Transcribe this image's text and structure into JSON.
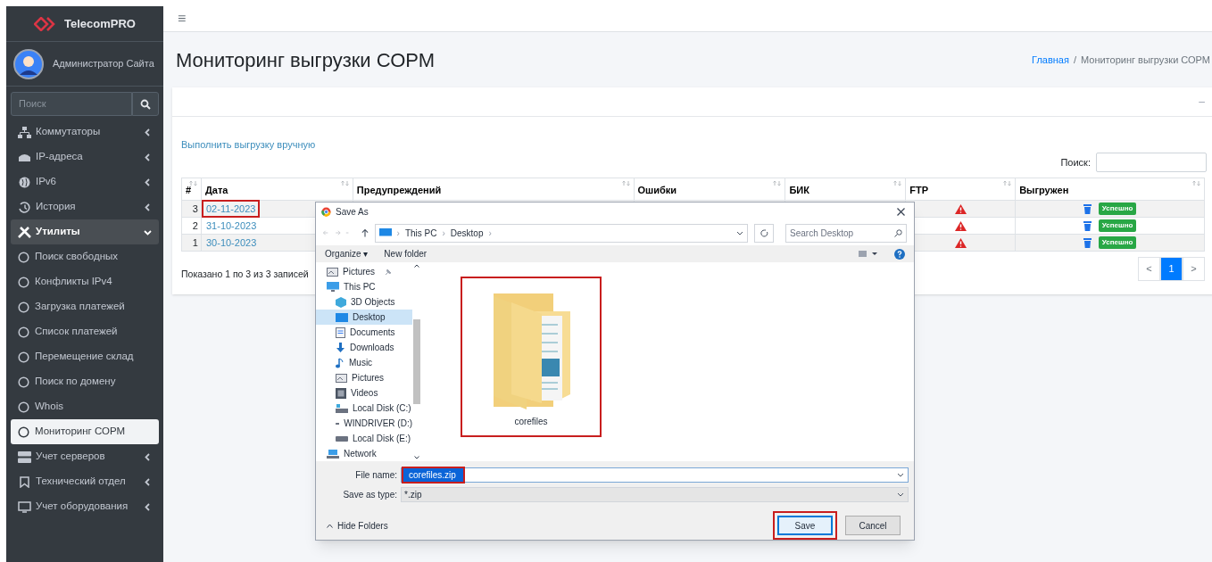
{
  "sidebar": {
    "brand": "TelecomPRO",
    "user": "Администратор Сайта",
    "search": {
      "placeholder": "Поиск"
    },
    "items": [
      {
        "label": "Коммутаторы",
        "expanded": false,
        "selected": false
      },
      {
        "label": "IP-адреса",
        "expanded": false,
        "selected": false
      },
      {
        "label": "IPv6",
        "expanded": false,
        "selected": false
      },
      {
        "label": "История",
        "expanded": false,
        "selected": false
      },
      {
        "label": "Утилиты",
        "expanded": true,
        "selected": false,
        "children": [
          {
            "label": "Поиск свободных",
            "selected": false
          },
          {
            "label": "Конфликты IPv4",
            "selected": false
          },
          {
            "label": "Загрузка платежей",
            "selected": false
          },
          {
            "label": "Список платежей",
            "selected": false
          },
          {
            "label": "Перемещение склад",
            "selected": false
          },
          {
            "label": "Поиск по домену",
            "selected": false
          },
          {
            "label": "Whois",
            "selected": false
          },
          {
            "label": "Мониторинг СОРМ",
            "selected": true
          }
        ]
      },
      {
        "label": "Учет серверов",
        "expanded": false,
        "selected": false
      },
      {
        "label": "Технический отдел",
        "expanded": false,
        "selected": false
      },
      {
        "label": "Учет оборудования",
        "expanded": false,
        "selected": false
      }
    ]
  },
  "topbar": {
    "menu_icon": "≡"
  },
  "page": {
    "title": "Мониторинг выгрузки СОРМ",
    "breadcrumbs": [
      "Главная",
      "Мониторинг выгрузки СОРМ"
    ],
    "breadcrumb_separator": "/",
    "collapse_symbol": "–"
  },
  "card": {
    "manual_link": "Выполнить выгрузку вручную",
    "search_label": "Поиск:",
    "table": {
      "columns": [
        "#",
        "Дата",
        "Предупреждений",
        "Ошибки",
        "БИК",
        "FTP",
        "Выгружен"
      ],
      "rows": [
        {
          "num": "3",
          "date": "02-11-2023",
          "date_highlighted": true,
          "ftp_warning": true,
          "status": "Успешно"
        },
        {
          "num": "2",
          "date": "31-10-2023",
          "date_highlighted": false,
          "ftp_warning": true,
          "status": "Успешно"
        },
        {
          "num": "1",
          "date": "30-10-2023",
          "date_highlighted": false,
          "ftp_warning": true,
          "status": "Успешно"
        }
      ]
    },
    "info": "Показано 1 по 3 из 3 записей",
    "pagination": [
      {
        "label": "<",
        "selected": false
      },
      {
        "label": "1",
        "selected": true
      },
      {
        "label": ">",
        "selected": false
      }
    ]
  },
  "dialog": {
    "title": "Save As",
    "path": [
      "This PC",
      "Desktop"
    ],
    "path_separator": "›",
    "search": {
      "placeholder": "Search Desktop"
    },
    "toolbar": [
      "Organize ▾",
      "New folder"
    ],
    "nav": [
      {
        "label": "Pictures",
        "pinned": true,
        "selected": false
      },
      {
        "label": "This PC",
        "pinned": false,
        "selected": false,
        "children": [
          {
            "label": "3D Objects",
            "selected": false
          },
          {
            "label": "Desktop",
            "selected": true
          },
          {
            "label": "Documents",
            "selected": false
          },
          {
            "label": "Downloads",
            "selected": false
          },
          {
            "label": "Music",
            "selected": false
          },
          {
            "label": "Pictures",
            "selected": false
          },
          {
            "label": "Videos",
            "selected": false
          },
          {
            "label": "Local Disk (C:)",
            "selected": false
          },
          {
            "label": "WINDRIVER (D:)",
            "selected": false
          },
          {
            "label": "Local Disk (E:)",
            "selected": false
          }
        ]
      },
      {
        "label": "Network",
        "pinned": false,
        "selected": false
      }
    ],
    "files": [
      {
        "name": "corefiles",
        "highlighted": true
      }
    ],
    "file_name": {
      "label": "File name:",
      "value": "corefiles.zip",
      "highlighted": true
    },
    "save_type": {
      "label": "Save as type:",
      "value": "*.zip"
    },
    "hide_folders": "Hide Folders",
    "buttons": [
      {
        "label": "Save",
        "kind": "primary",
        "highlighted": true
      },
      {
        "label": "Cancel",
        "kind": "secondary",
        "highlighted": false
      }
    ]
  }
}
